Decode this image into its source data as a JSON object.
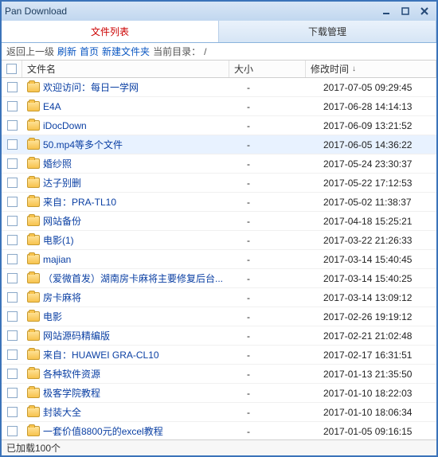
{
  "title": "Pan Download",
  "tabs": {
    "list": "文件列表",
    "download": "下载管理",
    "active": 0
  },
  "toolbar": {
    "back": "返回上一级",
    "refresh": "刷新",
    "home": "首页",
    "newfolder": "新建文件夹",
    "curdir_label": "当前目录：",
    "curdir_path": "/"
  },
  "columns": {
    "name": "文件名",
    "size": "大小",
    "time": "修改时间",
    "sort": "↓"
  },
  "rows": [
    {
      "name": "欢迎访问：每日一学网",
      "size": "-",
      "time": "2017-07-05 09:29:45"
    },
    {
      "name": "E4A",
      "size": "-",
      "time": "2017-06-28 14:14:13"
    },
    {
      "name": "iDocDown",
      "size": "-",
      "time": "2017-06-09 13:21:52"
    },
    {
      "name": "50.mp4等多个文件",
      "size": "-",
      "time": "2017-06-05 14:36:22",
      "hovered": true
    },
    {
      "name": "婚纱照",
      "size": "-",
      "time": "2017-05-24 23:30:37"
    },
    {
      "name": "达子别删",
      "size": "-",
      "time": "2017-05-22 17:12:53"
    },
    {
      "name": "来自：PRA-TL10",
      "size": "-",
      "time": "2017-05-02 11:38:37"
    },
    {
      "name": "网站备份",
      "size": "-",
      "time": "2017-04-18 15:25:21"
    },
    {
      "name": "电影(1)",
      "size": "-",
      "time": "2017-03-22 21:26:33"
    },
    {
      "name": "majian",
      "size": "-",
      "time": "2017-03-14 15:40:45"
    },
    {
      "name": "（爱微首发）湖南房卡麻将主要修复后台...",
      "size": "-",
      "time": "2017-03-14 15:40:25"
    },
    {
      "name": "房卡麻将",
      "size": "-",
      "time": "2017-03-14 13:09:12"
    },
    {
      "name": "电影",
      "size": "-",
      "time": "2017-02-26 19:19:12"
    },
    {
      "name": "网站源码精编版",
      "size": "-",
      "time": "2017-02-21 21:02:48"
    },
    {
      "name": "来自：HUAWEI GRA-CL10",
      "size": "-",
      "time": "2017-02-17 16:31:51"
    },
    {
      "name": "各种软件资源",
      "size": "-",
      "time": "2017-01-13 21:35:50"
    },
    {
      "name": "极客学院教程",
      "size": "-",
      "time": "2017-01-10 18:22:03"
    },
    {
      "name": "封装大全",
      "size": "-",
      "time": "2017-01-10 18:06:34"
    },
    {
      "name": "一套价值8800元的excel教程",
      "size": "-",
      "time": "2017-01-05 09:16:15"
    }
  ],
  "status": "已加载100个"
}
